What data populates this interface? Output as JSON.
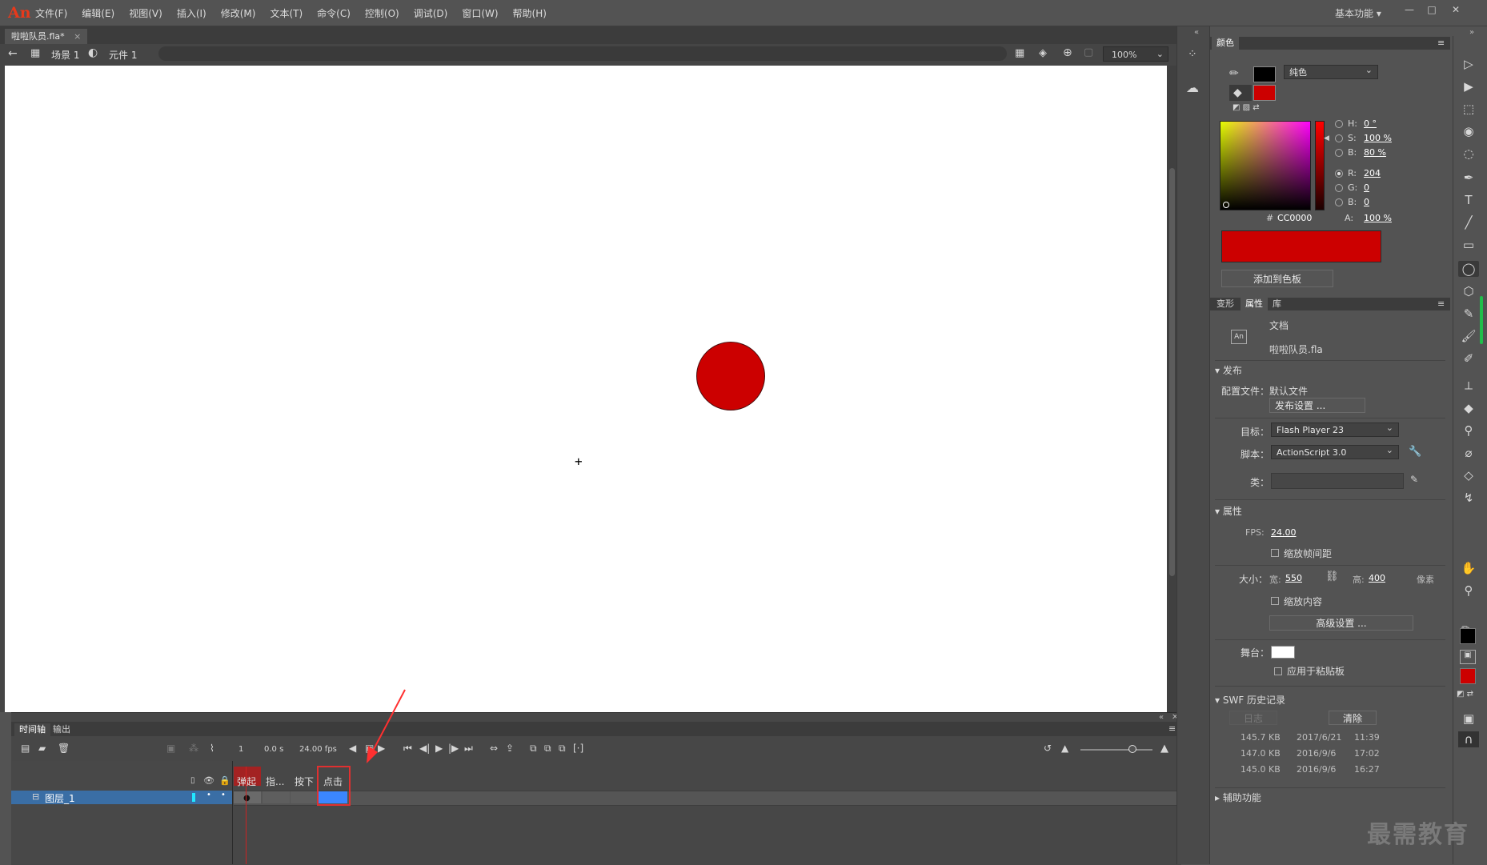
{
  "app": {
    "logo": "An"
  },
  "menu": [
    "文件(F)",
    "编辑(E)",
    "视图(V)",
    "插入(I)",
    "修改(M)",
    "文本(T)",
    "命令(C)",
    "控制(O)",
    "调试(D)",
    "窗口(W)",
    "帮助(H)"
  ],
  "workspace": {
    "label": "基本功能"
  },
  "window_controls": {
    "minimize": "—",
    "maximize": "□",
    "close": "✕"
  },
  "document_tab": {
    "title": "啦啦队员.fla*",
    "close": "×"
  },
  "editbar": {
    "scene": "场景 1",
    "symbol": "元件 1",
    "zoom": "100%"
  },
  "timeline": {
    "tabs": [
      "时间轴",
      "输出"
    ],
    "frame": "1",
    "time": "0.0 s",
    "fps": "24.00 fps",
    "frame_labels": [
      "弹起",
      "指...",
      "按下",
      "点击"
    ],
    "layer_name": "图层_1"
  },
  "color_panel": {
    "tab": "颜色",
    "fill_type": "纯色",
    "fields": [
      {
        "key": "H:",
        "value": "0 °",
        "selected": false
      },
      {
        "key": "S:",
        "value": "100 %",
        "selected": false
      },
      {
        "key": "B:",
        "value": "80 %",
        "selected": false
      },
      {
        "key": "R:",
        "value": "204",
        "selected": true
      },
      {
        "key": "G:",
        "value": "0",
        "selected": false
      },
      {
        "key": "B:",
        "value": "0",
        "selected": false
      }
    ],
    "hex_label": "#",
    "hex": "CC0000",
    "alpha_label": "A:",
    "alpha": "100 %",
    "add_swatch": "添加到色板",
    "fill_color": "#cc0000",
    "stroke_color": "#000000"
  },
  "props_panel": {
    "tabs": [
      "变形",
      "属性",
      "库"
    ],
    "doc_icon": "An",
    "doc_type": "文档",
    "doc_name": "啦啦队员.fla",
    "publish": {
      "section": "发布",
      "profile_label": "配置文件：",
      "profile_value": "默认文件",
      "settings_btn": "发布设置 ...",
      "target_label": "目标：",
      "target_value": "Flash Player 23",
      "script_label": "脚本：",
      "script_value": "ActionScript 3.0",
      "class_label": "类："
    },
    "properties": {
      "section": "属性",
      "fps_label": "FPS:",
      "fps_value": "24.00",
      "scale_spacing": "缩放帧间距",
      "size_label": "大小：",
      "width_label": "宽:",
      "width": "550",
      "height_label": "高:",
      "height": "400",
      "unit": "像素",
      "scale_content": "缩放内容",
      "advanced_btn": "高级设置 ...",
      "stage_label": "舞台：",
      "apply_pasteboard": "应用于粘贴板"
    },
    "swf_history": {
      "section": "SWF 历史记录",
      "log_btn": "日志",
      "clear_btn": "清除",
      "rows": [
        {
          "size": "145.7 KB",
          "date": "2017/6/21",
          "time": "11:39"
        },
        {
          "size": "147.0 KB",
          "date": "2016/9/6",
          "time": "17:02"
        },
        {
          "size": "145.0 KB",
          "date": "2016/9/6",
          "time": "16:27"
        }
      ]
    },
    "accessibility": {
      "section": "辅助功能"
    }
  },
  "watermark": "最需教育",
  "icons": {
    "back": "←",
    "scene": "🎬",
    "symbol": "◐",
    "tools": [
      "▷",
      "▶",
      "⬚",
      "◉",
      "◌",
      "✒",
      "T",
      "╱",
      "▭",
      "◯",
      "⬡",
      "✎",
      "🖌",
      "✐",
      "⟂",
      "◆",
      "⚲",
      "⌀",
      "◇",
      "↯",
      "✋",
      "⚲"
    ]
  }
}
